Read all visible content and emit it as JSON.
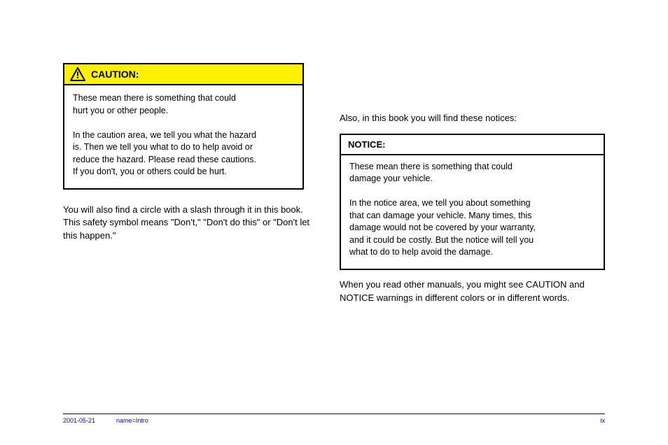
{
  "caution": {
    "label": "CAUTION:",
    "body_lines": [
      "These mean there is something that could",
      "hurt you or other people.",
      "",
      "In the caution area, we tell you what the hazard",
      "is. Then we tell you what to do to help avoid or",
      "reduce the hazard. Please read these cautions.",
      "If you don't, you or others could be hurt."
    ]
  },
  "left_para": "You will also find a circle with a slash through it in this book. This safety symbol means \"Don't,\" \"Don't do this\" or \"Don't let this happen.\"",
  "right_intro": "Also, in this book you will find these notices:",
  "notice": {
    "header": "NOTICE:",
    "body_lines": [
      "These mean there is something that could",
      "damage your vehicle.",
      "",
      "In the notice area, we tell you about something",
      "that can damage your vehicle. Many times, this",
      "damage would not be covered by your warranty,",
      "and it could be costly. But the notice will tell you",
      "what to do to help avoid the damage."
    ]
  },
  "closing": "When you read other manuals, you might see CAUTION and NOTICE warnings in different colors or in different words.",
  "footer": {
    "date": "2001-05-21",
    "code": "name=Intro",
    "page": "ix"
  },
  "icons": {
    "alert": "alert-triangle-icon"
  }
}
